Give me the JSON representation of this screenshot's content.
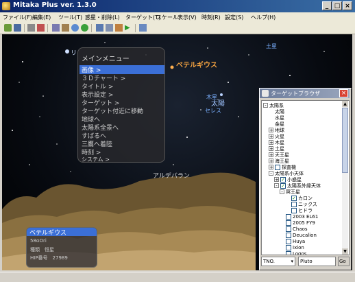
{
  "window": {
    "title": "Mitaka Plus ver. 1.3.0",
    "buttons": [
      "_",
      "□",
      "×"
    ]
  },
  "menubar": [
    "ファイル(F)",
    "編集(E)",
    "ツール(T)",
    "惑星・削除(L)",
    "ターゲット(T)",
    "スケール",
    "表示(V)",
    "時刻(R)",
    "設定(S)",
    "ヘルプ(H)"
  ],
  "sky_labels": {
    "betelgeuse": "ベテルギウス",
    "saturn": "土星",
    "aldebaran": "アルデバラン",
    "jupiter": "木星",
    "sun": "太陽",
    "ceres": "セレス",
    "ri": "リ"
  },
  "main_menu": {
    "title": "メインメニュー",
    "items": [
      "画像 >",
      "３Ｄチャート >",
      "タイトル >",
      "表示設定 >",
      "ターゲット >",
      "ターゲット付近に移動",
      "地球へ",
      "太陽系全景へ",
      "すばるへ",
      "三鷹へ着陸",
      "時刻 >",
      "システム >"
    ]
  },
  "info_box": {
    "title": "ベテルギウス",
    "lines": [
      "58αOri",
      "種類　恒星",
      "HIP番号　27989"
    ]
  },
  "target_browser": {
    "title": "ターゲットブラウザ",
    "tree": [
      {
        "label": "太陽系",
        "level": 0,
        "pm": "-"
      },
      {
        "label": "太陽",
        "level": 1
      },
      {
        "label": "水星",
        "level": 1
      },
      {
        "label": "金星",
        "level": 1
      },
      {
        "label": "地球",
        "level": 1,
        "pm": "+"
      },
      {
        "label": "火星",
        "level": 1,
        "pm": "+"
      },
      {
        "label": "木星",
        "level": 1,
        "pm": "+"
      },
      {
        "label": "土星",
        "level": 1,
        "pm": "+"
      },
      {
        "label": "天王星",
        "level": 1,
        "pm": "+"
      },
      {
        "label": "海王星",
        "level": 1,
        "pm": "+"
      },
      {
        "label": "探査機",
        "level": 1,
        "pm": "+",
        "cb": false
      },
      {
        "label": "太陽系小天体",
        "level": 1,
        "pm": "-"
      },
      {
        "label": "小惑星",
        "level": 2,
        "pm": "+",
        "cb": true
      },
      {
        "label": "太陽系外縁天体",
        "level": 2,
        "pm": "-",
        "cb": true
      },
      {
        "label": "冥王星",
        "level": 3,
        "pm": "-"
      },
      {
        "label": "カロン",
        "level": 4,
        "cb": true
      },
      {
        "label": "ニックス",
        "level": 4,
        "cb": false
      },
      {
        "label": "ヒドラ",
        "level": 4,
        "cb": false
      },
      {
        "label": "2003 EL61",
        "level": 3,
        "cb": false
      },
      {
        "label": "2005 FY9",
        "level": 3,
        "cb": false
      },
      {
        "label": "Chaos",
        "level": 3,
        "cb": false
      },
      {
        "label": "Deucalion",
        "level": 3,
        "cb": false
      },
      {
        "label": "Huya",
        "level": 3,
        "cb": false
      },
      {
        "label": "Ixion",
        "level": 3,
        "cb": false
      },
      {
        "label": "Logos",
        "level": 3,
        "cb": false
      }
    ],
    "type_select": "TNO.",
    "search_value": "Pluto",
    "go_label": "Go"
  },
  "colors": {
    "accent": "#3b6fd6",
    "star_label": "#f0a040",
    "planet_label": "#7ab0ff"
  }
}
